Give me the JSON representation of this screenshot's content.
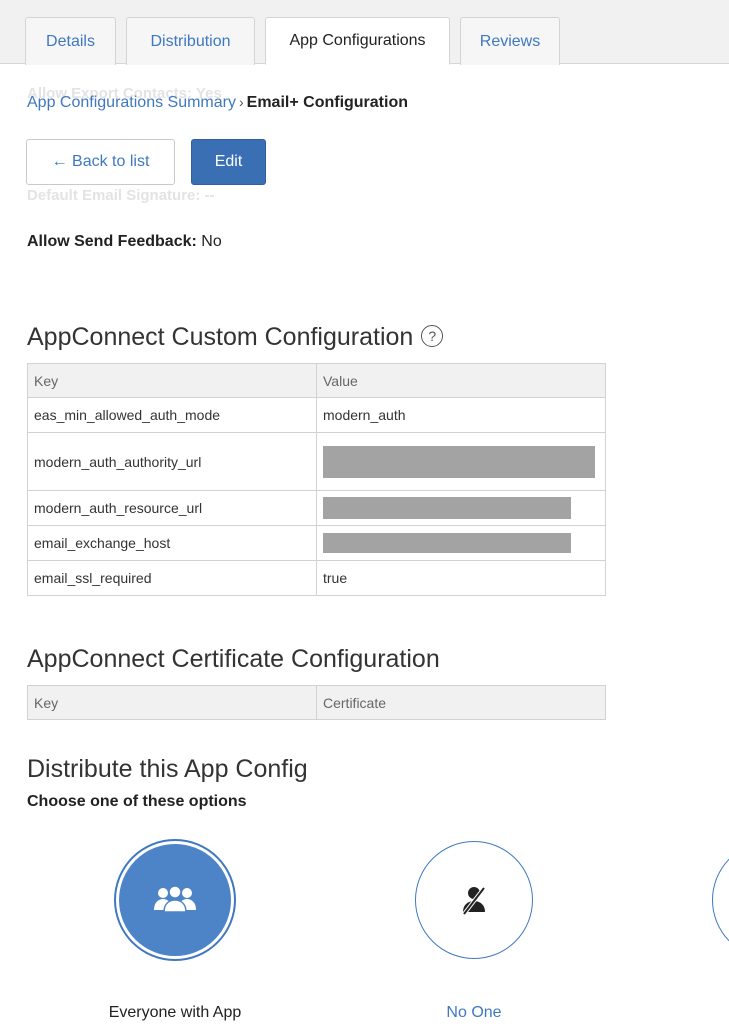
{
  "tabs": [
    {
      "label": "Details",
      "active": false
    },
    {
      "label": "Distribution",
      "active": false
    },
    {
      "label": "App Configurations",
      "active": true
    },
    {
      "label": "Reviews",
      "active": false
    }
  ],
  "breadcrumb": {
    "parent": "App Configurations Summary",
    "separator": "›",
    "current": "Email+ Configuration"
  },
  "ghost": {
    "line1": "Allow Export Contacts: Yes",
    "line2": "Default Email Signature: --"
  },
  "buttons": {
    "back": "← Back to list",
    "edit": "Edit"
  },
  "feedback": {
    "label": "Allow Send Feedback:",
    "value": "No"
  },
  "custom_config": {
    "title": "AppConnect Custom Configuration",
    "help_icon": "?",
    "headers": {
      "key": "Key",
      "value": "Value"
    },
    "rows": [
      {
        "key": "eas_min_allowed_auth_mode",
        "value": "modern_auth"
      },
      {
        "key": "modern_auth_authority_url",
        "value": ""
      },
      {
        "key": "modern_auth_resource_url",
        "value": ""
      },
      {
        "key": "email_exchange_host",
        "value": ""
      },
      {
        "key": "email_ssl_required",
        "value": "true"
      }
    ]
  },
  "cert_config": {
    "title": "AppConnect Certificate Configuration",
    "headers": {
      "key": "Key",
      "value": "Certificate"
    }
  },
  "distribute": {
    "title": "Distribute this App Config",
    "subtitle": "Choose one of these options",
    "options": [
      {
        "label": "Everyone with App",
        "icon": "group-icon",
        "selected": true
      },
      {
        "label": "No One",
        "icon": "no-user-icon",
        "selected": false
      }
    ]
  },
  "colors": {
    "link": "#3f78c0",
    "primary_button": "#3a6fb3",
    "selected_option": "#4d84c8",
    "redacted": "#a3a3a3"
  }
}
